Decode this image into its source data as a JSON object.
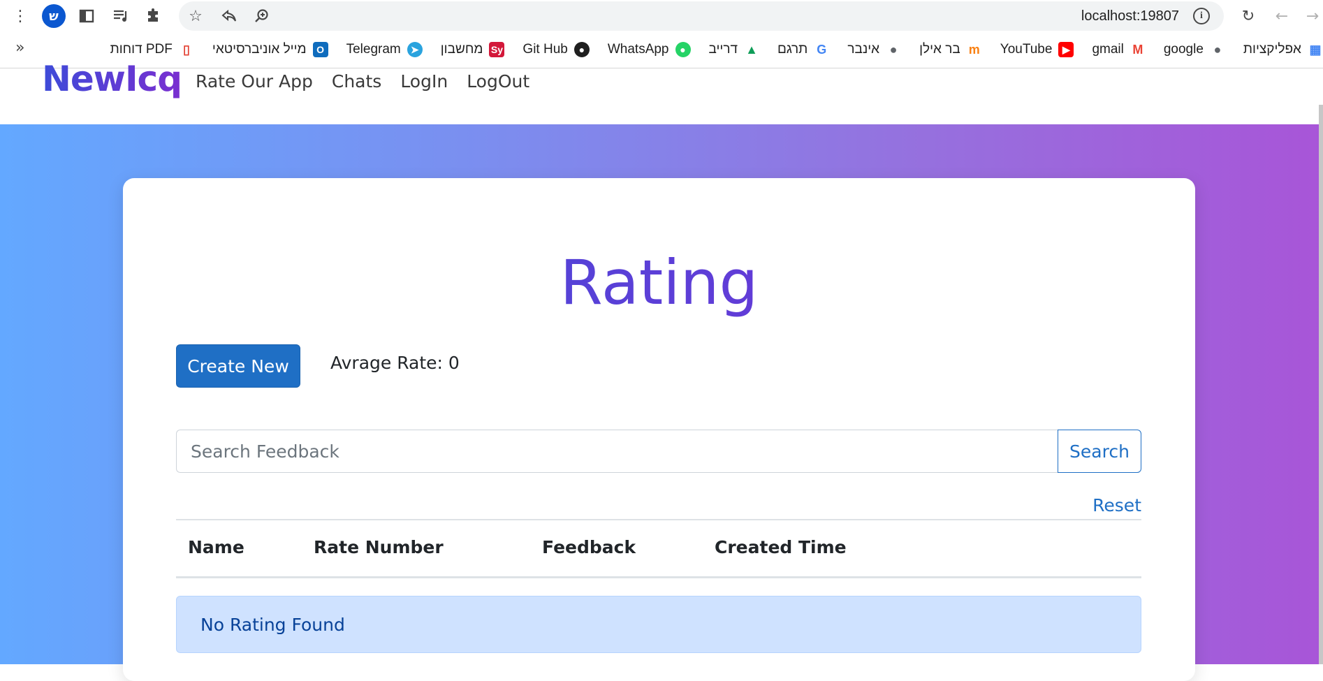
{
  "browser": {
    "profile_initial": "ש",
    "url": "localhost:19807"
  },
  "bookmarks": [
    {
      "label": "אפליקציות",
      "icon": "apps-grid-icon",
      "color": "#4285f4"
    },
    {
      "label": "google",
      "icon": "globe-icon",
      "color": "#5f6368"
    },
    {
      "label": "gmail",
      "icon": "gmail-icon",
      "color": "#ea4335"
    },
    {
      "label": "YouTube",
      "icon": "youtube-icon",
      "color": "#ff0000"
    },
    {
      "label": "בר אילן",
      "icon": "moodle-icon",
      "color": "#f98012"
    },
    {
      "label": "אינבר",
      "icon": "globe-icon",
      "color": "#5f6368"
    },
    {
      "label": "תרגם",
      "icon": "translate-icon",
      "color": "#4285f4"
    },
    {
      "label": "דרייב",
      "icon": "drive-icon",
      "color": "#0f9d58"
    },
    {
      "label": "WhatsApp",
      "icon": "whatsapp-icon",
      "color": "#25d366"
    },
    {
      "label": "Git Hub",
      "icon": "github-icon",
      "color": "#1f1f1f"
    },
    {
      "label": "מחשבון",
      "icon": "symbolab-icon",
      "color": "#d3183a"
    },
    {
      "label": "Telegram",
      "icon": "telegram-icon",
      "color": "#2aa3de"
    },
    {
      "label": "מייל אוניברסיטאי",
      "icon": "outlook-icon",
      "color": "#0f6cbd"
    },
    {
      "label": "דוחות PDF",
      "icon": "pdf-icon",
      "color": "#e34133"
    }
  ],
  "bookmarks_overflow": "»",
  "navbar": {
    "brand": "NewIcq",
    "links": [
      "Rate Our App",
      "Chats",
      "LogIn",
      "LogOut"
    ]
  },
  "page": {
    "title": "Rating",
    "create_button": "Create New",
    "average_label": "Avrage Rate: 0",
    "search_placeholder": "Search Feedback",
    "search_button": "Search",
    "reset_link": "Reset",
    "columns": [
      "Name",
      "Rate Number",
      "Feedback",
      "Created Time"
    ],
    "empty_message": "No Rating Found"
  },
  "colors": {
    "primary": "#1f6fc5",
    "gradient_start": "#63a8ff",
    "gradient_end": "#a855d8",
    "alert_bg": "#cfe2ff",
    "alert_text": "#084298"
  }
}
